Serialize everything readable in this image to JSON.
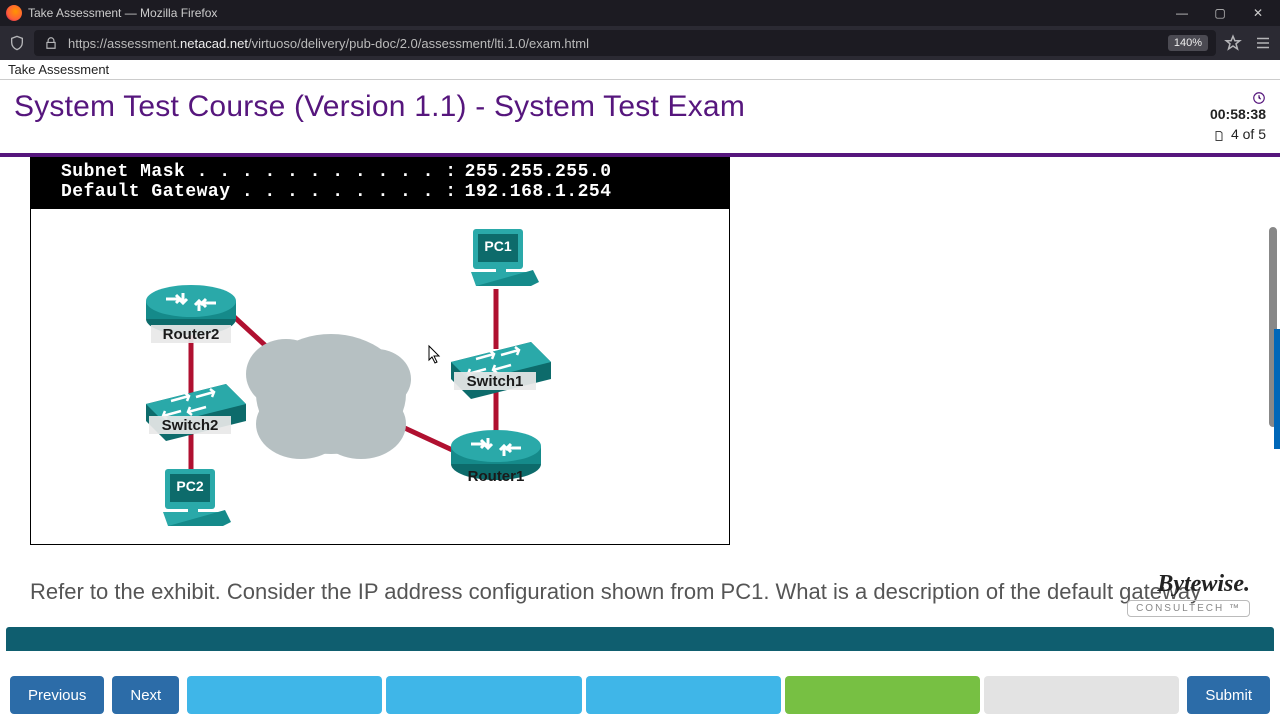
{
  "window": {
    "title": "Take Assessment — Mozilla Firefox",
    "url_prefix": "https://assessment.",
    "url_domain": "netacad.net",
    "url_path": "/virtuoso/delivery/pub-doc/2.0/assessment/lti.1.0/exam.html",
    "zoom": "140%"
  },
  "breadcrumb": "Take Assessment",
  "header": {
    "title": "System Test Course (Version 1.1) - System Test Exam",
    "timer": "00:58:38",
    "page_counter": "4 of 5"
  },
  "exhibit": {
    "terminal_lines": [
      {
        "label": "Subnet Mask",
        "value": "255.255.255.0"
      },
      {
        "label": "Default Gateway",
        "value": "192.168.1.254"
      }
    ],
    "devices": {
      "pc1": "PC1",
      "pc2": "PC2",
      "switch1": "Switch1",
      "switch2": "Switch2",
      "router1": "Router1",
      "router2": "Router2"
    }
  },
  "question_text": "Refer to the exhibit. Consider the IP address configuration shown from PC1. What is a description of the default gateway",
  "watermark": {
    "brand": "Bytewise.",
    "sub": "CONSULTECH ™"
  },
  "footer": {
    "previous": "Previous",
    "next": "Next",
    "submit": "Submit",
    "segments": [
      {
        "state": "answered"
      },
      {
        "state": "answered"
      },
      {
        "state": "answered"
      },
      {
        "state": "current"
      },
      {
        "state": "todo"
      }
    ]
  }
}
